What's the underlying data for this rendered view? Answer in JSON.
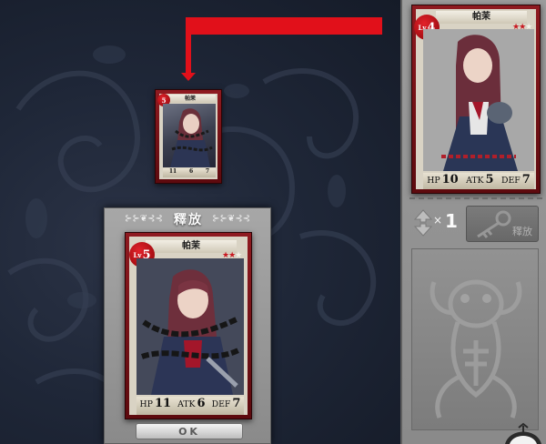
{
  "dialog": {
    "title": "釋放",
    "ok_label": "OK"
  },
  "small_card": {
    "name": "帕茉",
    "level": "5",
    "hp": "11",
    "atk": "6",
    "def": "7"
  },
  "big_card": {
    "name": "帕茉",
    "level_prefix": "Lv",
    "level": "5",
    "rarity": "3",
    "hp_label": "HP",
    "hp": "11",
    "atk_label": "ATK",
    "atk": "6",
    "def_label": "DEF",
    "def": "7"
  },
  "preview_card": {
    "name": "帕茉",
    "level_prefix": "Lv",
    "level": "4",
    "rarity": "3",
    "hp_label": "HP",
    "hp": "10",
    "atk_label": "ATK",
    "atk": "5",
    "def_label": "DEF",
    "def": "7"
  },
  "right_panel": {
    "multiplier": "×",
    "count": "1",
    "release_label": "釋放"
  },
  "colors": {
    "indicator": "#e1101a",
    "card_frame": "#8f1a20",
    "background": "#1e2637",
    "panel": "#959595"
  },
  "icons": {
    "arrows": "up-down-arrows-icon",
    "release": "key-icon",
    "frog": "frog-silhouette-icon"
  }
}
